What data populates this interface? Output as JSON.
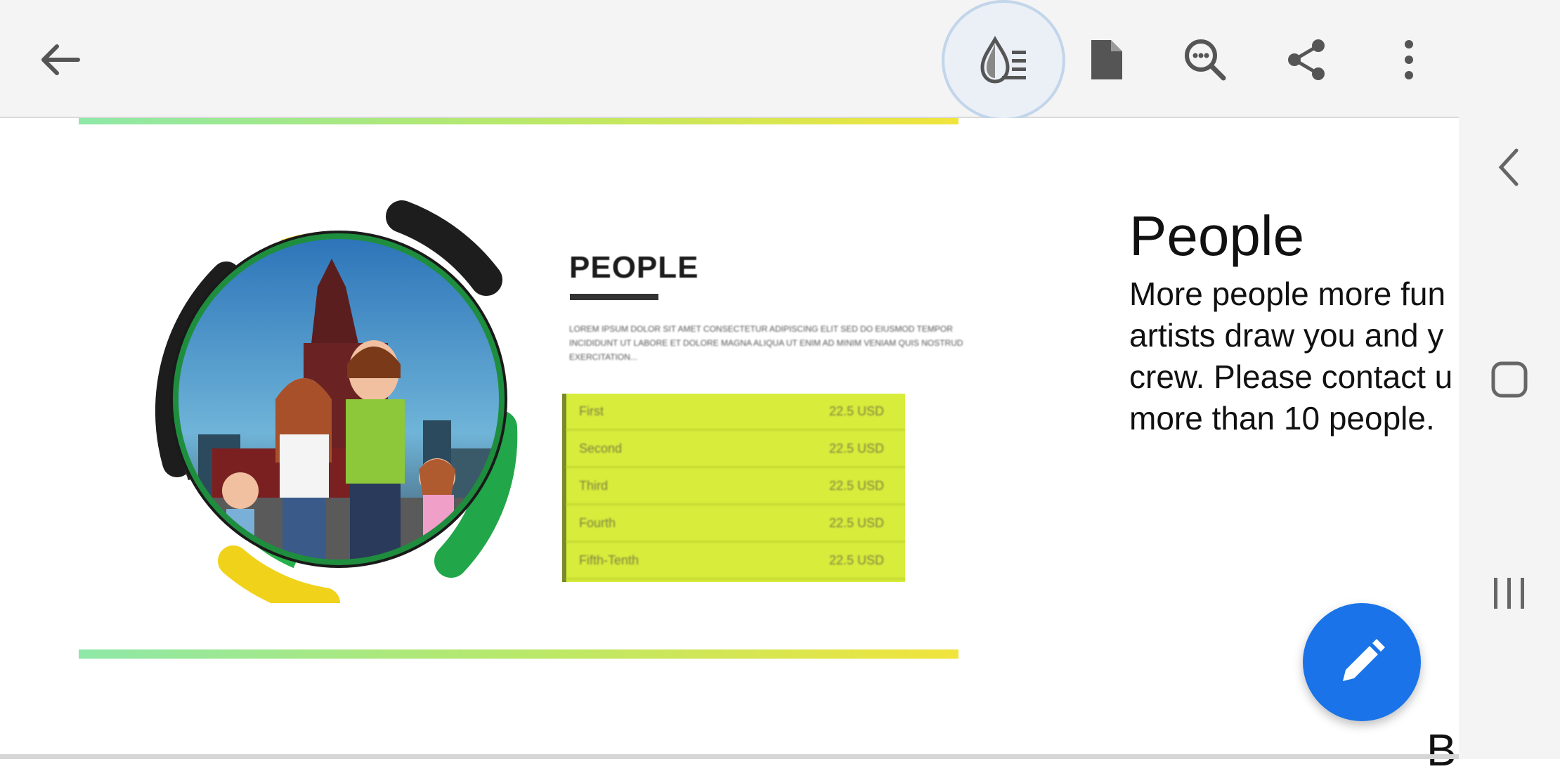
{
  "toolbar": {
    "back_icon": "arrow-left-icon",
    "reading_mode_icon": "water-drop-text-icon",
    "document_icon": "document-icon",
    "find_icon": "search-comment-icon",
    "share_icon": "share-icon",
    "more_icon": "more-vertical-icon"
  },
  "slide": {
    "heading": "PEOPLE",
    "lorem": "LOREM IPSUM DOLOR SIT AMET CONSECTETUR ADIPISCING ELIT SED DO EIUSMOD TEMPOR INCIDIDUNT UT LABORE ET DOLORE MAGNA ALIQUA UT ENIM AD MINIM VENIAM QUIS NOSTRUD EXERCITATION...",
    "rows": [
      {
        "label": "First",
        "price": "22.5 USD"
      },
      {
        "label": "Second",
        "price": "22.5 USD"
      },
      {
        "label": "Third",
        "price": "22.5 USD"
      },
      {
        "label": "Fourth",
        "price": "22.5 USD"
      },
      {
        "label": "Fifth-Tenth",
        "price": "22.5 USD"
      }
    ]
  },
  "notes": {
    "title": "People",
    "lines": [
      "More people more fun",
      "artists draw you and y",
      "crew. Please contact u",
      "more than 10 people."
    ],
    "next_heading_fragment": "B"
  },
  "fab": {
    "icon": "pencil-icon"
  },
  "nav": {
    "back_icon": "chevron-left-icon",
    "home_icon": "square-home-icon",
    "recents_icon": "recents-icon"
  },
  "colors": {
    "accent": "#1a73e8",
    "table": "#d8ec3c"
  }
}
